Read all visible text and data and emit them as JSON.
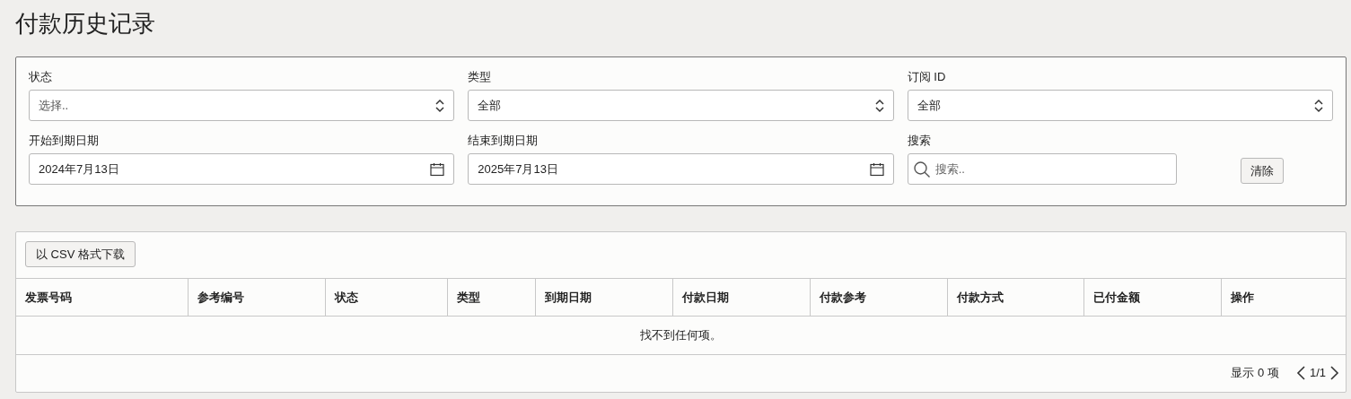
{
  "title": "付款历史记录",
  "filters": [
    {
      "kind": "select",
      "label": "状态",
      "placeholder": "选择.."
    },
    {
      "kind": "select",
      "label": "类型",
      "value": "全部"
    },
    {
      "kind": "select",
      "label": "订阅 ID",
      "value": "全部"
    },
    {
      "kind": "date",
      "label": "开始到期日期",
      "value": "2024年7月13日"
    },
    {
      "kind": "date",
      "label": "结束到期日期",
      "value": "2025年7月13日"
    },
    {
      "kind": "search",
      "label": "搜索",
      "placeholder": "搜索.."
    }
  ],
  "clear_button": "清除",
  "download_button": "以 CSV 格式下载",
  "table": {
    "columns": [
      "发票号码",
      "参考编号",
      "状态",
      "类型",
      "到期日期",
      "付款日期",
      "付款参考",
      "付款方式",
      "已付金额",
      "操作"
    ],
    "empty_message": "找不到任何项。"
  },
  "footer": {
    "count": "显示 0 项",
    "page": "1/1"
  }
}
